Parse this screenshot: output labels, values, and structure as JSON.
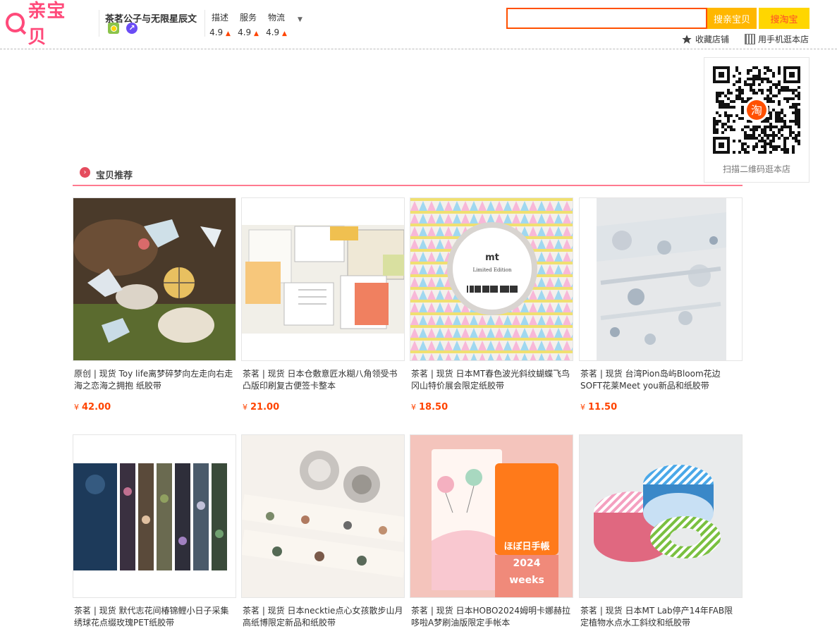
{
  "header": {
    "logo_text": "亲宝贝",
    "shop_name": "茶茗公子与无限星辰文",
    "ratings": [
      {
        "label": "描述",
        "value": "4.9",
        "trend": "up"
      },
      {
        "label": "服务",
        "value": "4.9",
        "trend": "up"
      },
      {
        "label": "物流",
        "value": "4.9",
        "trend": "up"
      }
    ],
    "search": {
      "value": "",
      "btn_qin": "搜亲宝贝",
      "btn_taobao": "搜淘宝"
    },
    "fav_shop": "收藏店铺",
    "mobile_shop": "用手机逛本店"
  },
  "qr": {
    "caption": "扫描二维码逛本店",
    "logo_char": "淘"
  },
  "section": {
    "title": "宝贝推荐"
  },
  "items": [
    {
      "title": "原创 | 现货 Toy life离梦碎梦向左走向右走海之恋海之拥抱 纸胶带",
      "price": "42.00"
    },
    {
      "title": "茶茗 | 现货 日本仓敷意匠水糊八角领受书凸版印刷复古便签卡整本",
      "price": "21.00"
    },
    {
      "title": "茶茗 | 现货 日本MT春色波光斜纹蝴蝶飞鸟冈山特价展会限定纸胶带",
      "price": "18.50"
    },
    {
      "title": "茶茗 | 现货 台湾Pion岛屿Bloom花边SOFT花莱Meet you新品和纸胶带",
      "price": "11.50"
    },
    {
      "title": "茶茗 | 现货 默代志花间椿锦鲤小日子采集绣球花点缀玫瑰PET纸胶带",
      "price": ""
    },
    {
      "title": "茶茗 | 现货 日本necktie点心女孩散步山月高纸博限定新品和纸胶带",
      "price": ""
    },
    {
      "title": "茶茗 | 现货 日本HOBO2024姆明卡娜赫拉哆啦A梦刷油版限定手帐本",
      "price": ""
    },
    {
      "title": "茶茗 | 现货 日本MT Lab停产14年FAB限定植物水点水工斜纹和纸胶带",
      "price": ""
    }
  ],
  "currency": "¥",
  "colors": {
    "accent": "#ff5000",
    "brand": "#ff4a7a",
    "price": "#ff4400"
  }
}
